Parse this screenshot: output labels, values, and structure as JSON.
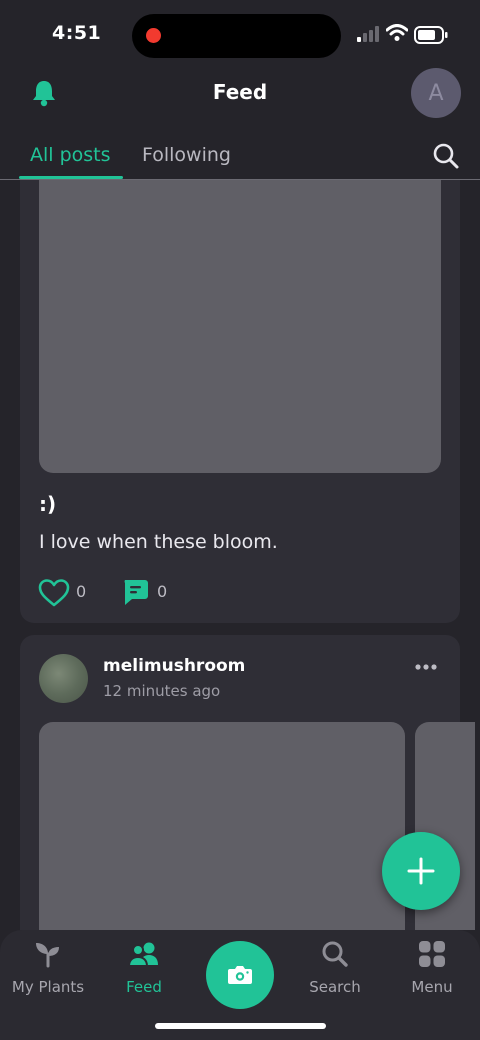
{
  "status_bar": {
    "time": "4:51"
  },
  "header": {
    "title": "Feed",
    "avatar_initial": "A"
  },
  "tabs": [
    {
      "label": "All posts",
      "active": true
    },
    {
      "label": "Following",
      "active": false
    }
  ],
  "posts": [
    {
      "title": ":)",
      "text": "I love when these bloom.",
      "likes": "0",
      "comments": "0"
    },
    {
      "author": "melimushroom",
      "time": "12 minutes ago"
    }
  ],
  "bottom_nav": {
    "items": [
      {
        "label": "My Plants",
        "icon": "sprout-icon",
        "active": false
      },
      {
        "label": "Feed",
        "icon": "people-icon",
        "active": true
      },
      {
        "label": "Search",
        "icon": "search-icon",
        "active": false
      },
      {
        "label": "Menu",
        "icon": "grid-icon",
        "active": false
      }
    ]
  },
  "colors": {
    "accent": "#21c397",
    "background": "#25242a",
    "card": "#2f2e36",
    "placeholder": "#605f66"
  }
}
